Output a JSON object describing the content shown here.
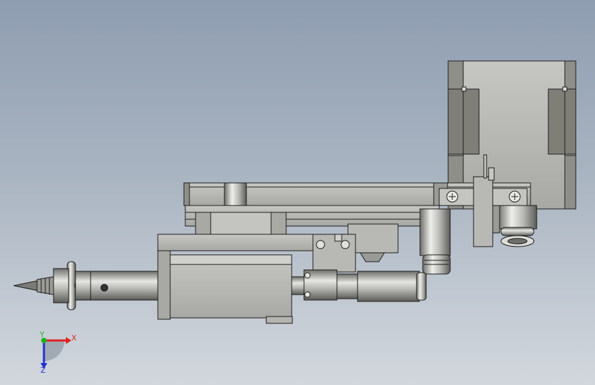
{
  "viewport": {
    "background_top": "#8e9db0",
    "background_bottom": "#d2d7dd"
  },
  "model": {
    "body_color": "#b4b4b0",
    "shade_color": "#8f8f8a",
    "dark_panel_color": "#7f7f78",
    "outline_color": "#1a1a1a"
  },
  "triad": {
    "x_label": "X",
    "y_label": "Y",
    "z_label": "Z",
    "x_color": "#e02020",
    "y_color": "#20b020",
    "z_color": "#2030d0"
  }
}
